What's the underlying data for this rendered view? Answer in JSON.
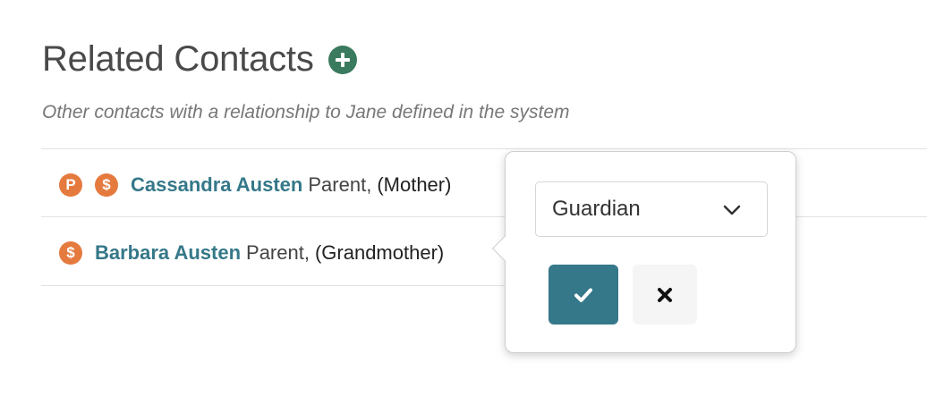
{
  "section": {
    "title": "Related Contacts",
    "subtitle": "Other contacts with a relationship to Jane defined in the system"
  },
  "icons": {
    "add": "plus-circle-icon",
    "chevron": "chevron-down-icon",
    "confirm": "check-icon",
    "cancel": "close-icon"
  },
  "contacts": [
    {
      "badges": [
        "P",
        "$"
      ],
      "name": "Cassandra Austen",
      "role": "Parent,",
      "relationship": "(Mother)"
    },
    {
      "badges": [
        "$"
      ],
      "name": "Barbara Austen",
      "role": "Parent,",
      "relationship": "(Grandmother)"
    }
  ],
  "popover": {
    "selected": "Guardian"
  },
  "colors": {
    "accent": "#357889",
    "badge": "#e57a3f",
    "add": "#3a7a5e"
  }
}
